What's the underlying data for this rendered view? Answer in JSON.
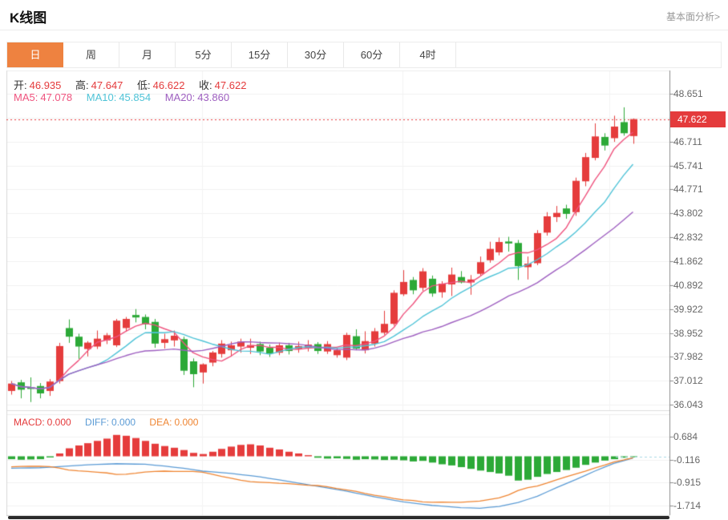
{
  "header": {
    "title": "K线图",
    "more_link": "基本面分析>"
  },
  "toolbar": {
    "tabs": [
      "日",
      "周",
      "月",
      "5分",
      "15分",
      "30分",
      "60分",
      "4时"
    ],
    "tab_ids": [
      "day",
      "week",
      "month",
      "5min",
      "15min",
      "30min",
      "60min",
      "4hour"
    ],
    "active_tab": "日"
  },
  "ohlc": {
    "open_label": "开:",
    "open": "46.935",
    "high_label": "高:",
    "high": "47.647",
    "low_label": "低:",
    "low": "46.622",
    "close_label": "收:",
    "close": "47.622"
  },
  "ma": {
    "ma5_label": "MA5:",
    "ma5": "47.078",
    "ma10_label": "MA10:",
    "ma10": "45.854",
    "ma20_label": "MA20:",
    "ma20": "43.860"
  },
  "macd": {
    "macd_label": "MACD:",
    "macd": "0.000",
    "diff_label": "DIFF:",
    "diff": "0.000",
    "dea_label": "DEA:",
    "dea": "0.000"
  },
  "price_tag": "47.622",
  "colors": {
    "up": "#e53c3c",
    "down": "#2ca937",
    "ma5": "#ef537e",
    "ma10": "#4fc3d7",
    "ma20": "#9e5fc0",
    "diff": "#5b9bd5",
    "dea": "#ef8532",
    "accent": "#ee8240",
    "price_line": "#e43b3c",
    "value_red": "#e43b3c",
    "macd_dash": "#a8d8e6"
  },
  "chart_data": {
    "type": "candlestick",
    "title": "K线图",
    "panes": [
      "price",
      "macd-histogram"
    ],
    "grid": true,
    "legend_position": "top-left-overlay",
    "price_min": 36.043,
    "price_max": 48.651,
    "price_grid_step": 0.9699,
    "current_price": 47.622,
    "price_ticks": [
      "48.651",
      "46.711",
      "45.741",
      "44.771",
      "43.802",
      "42.832",
      "41.862",
      "40.892",
      "39.922",
      "38.952",
      "37.982",
      "37.012",
      "36.043"
    ],
    "price_tick_values": [
      48.651,
      46.711,
      45.741,
      44.771,
      43.802,
      42.832,
      41.862,
      40.892,
      39.922,
      38.952,
      37.982,
      37.012,
      36.043
    ],
    "ma_periods": [
      5,
      10,
      20
    ],
    "candles_ohlc": [
      [
        36.6,
        37.0,
        36.45,
        36.9
      ],
      [
        36.95,
        37.05,
        36.3,
        36.65
      ],
      [
        36.75,
        37.15,
        36.15,
        36.68
      ],
      [
        36.8,
        36.92,
        36.3,
        36.5
      ],
      [
        36.6,
        37.08,
        36.4,
        36.98
      ],
      [
        37.0,
        38.55,
        36.9,
        38.42
      ],
      [
        39.15,
        39.5,
        38.55,
        38.8
      ],
      [
        38.8,
        38.92,
        37.9,
        38.4
      ],
      [
        38.3,
        38.62,
        38.0,
        38.56
      ],
      [
        38.4,
        39.05,
        38.3,
        38.72
      ],
      [
        38.65,
        38.95,
        38.5,
        38.86
      ],
      [
        38.45,
        39.52,
        38.38,
        39.45
      ],
      [
        39.15,
        39.6,
        39.0,
        39.52
      ],
      [
        39.68,
        39.92,
        39.38,
        39.58
      ],
      [
        39.6,
        39.7,
        39.1,
        39.3
      ],
      [
        39.4,
        39.52,
        38.35,
        38.52
      ],
      [
        38.55,
        38.92,
        38.32,
        38.7
      ],
      [
        38.65,
        39.05,
        38.4,
        38.84
      ],
      [
        38.7,
        38.8,
        37.25,
        37.42
      ],
      [
        37.8,
        37.92,
        36.75,
        37.28
      ],
      [
        37.35,
        37.72,
        36.9,
        37.68
      ],
      [
        37.75,
        38.22,
        37.6,
        38.16
      ],
      [
        38.1,
        38.66,
        37.95,
        38.52
      ],
      [
        38.25,
        38.6,
        38.0,
        38.45
      ],
      [
        38.4,
        38.72,
        38.15,
        38.6
      ],
      [
        38.35,
        38.72,
        38.1,
        38.46
      ],
      [
        38.5,
        38.6,
        38.05,
        38.2
      ],
      [
        38.35,
        38.48,
        37.98,
        38.12
      ],
      [
        38.15,
        38.56,
        38.05,
        38.45
      ],
      [
        38.45,
        38.55,
        38.08,
        38.22
      ],
      [
        38.3,
        38.6,
        38.15,
        38.42
      ],
      [
        38.35,
        38.66,
        38.2,
        38.48
      ],
      [
        38.5,
        38.58,
        38.1,
        38.22
      ],
      [
        38.2,
        38.62,
        38.1,
        38.5
      ],
      [
        38.05,
        38.32,
        37.95,
        38.25
      ],
      [
        37.95,
        38.96,
        37.85,
        38.87
      ],
      [
        38.82,
        39.1,
        38.25,
        38.32
      ],
      [
        38.25,
        39.02,
        38.12,
        38.62
      ],
      [
        38.52,
        39.15,
        38.4,
        39.02
      ],
      [
        38.96,
        39.85,
        38.88,
        39.32
      ],
      [
        39.32,
        40.68,
        39.25,
        40.58
      ],
      [
        40.52,
        41.5,
        40.45,
        41.02
      ],
      [
        41.1,
        41.22,
        40.52,
        40.68
      ],
      [
        40.78,
        41.58,
        40.65,
        41.45
      ],
      [
        41.15,
        41.28,
        40.42,
        40.55
      ],
      [
        40.6,
        41.05,
        40.38,
        40.95
      ],
      [
        40.92,
        41.6,
        40.45,
        41.32
      ],
      [
        41.22,
        41.46,
        40.96,
        41.0
      ],
      [
        41.0,
        41.3,
        40.5,
        41.12
      ],
      [
        41.35,
        42.05,
        41.25,
        41.82
      ],
      [
        41.9,
        42.65,
        41.8,
        42.36
      ],
      [
        42.22,
        42.82,
        42.1,
        42.64
      ],
      [
        42.66,
        42.85,
        42.25,
        42.58
      ],
      [
        42.6,
        42.72,
        41.1,
        41.66
      ],
      [
        41.62,
        42.05,
        41.12,
        41.76
      ],
      [
        41.78,
        43.12,
        41.7,
        43.0
      ],
      [
        43.02,
        43.85,
        42.9,
        43.68
      ],
      [
        43.65,
        44.1,
        43.45,
        43.82
      ],
      [
        44.0,
        44.15,
        43.58,
        43.78
      ],
      [
        43.85,
        45.25,
        43.7,
        45.12
      ],
      [
        45.1,
        46.25,
        44.9,
        46.08
      ],
      [
        46.05,
        47.45,
        45.95,
        46.92
      ],
      [
        46.9,
        47.05,
        46.35,
        46.55
      ],
      [
        46.85,
        47.76,
        46.7,
        47.32
      ],
      [
        47.5,
        48.1,
        46.95,
        47.05
      ],
      [
        46.935,
        47.647,
        46.622,
        47.622
      ]
    ],
    "macd_ticks": [
      "0.684",
      "-0.116",
      "-0.915",
      "-1.714"
    ],
    "macd_tick_values": [
      0.684,
      -0.116,
      -0.915,
      -1.714
    ],
    "macd_current": 0.0,
    "macd_histogram": [
      -0.1,
      -0.12,
      -0.11,
      -0.1,
      -0.04,
      0.1,
      0.28,
      0.38,
      0.46,
      0.54,
      0.62,
      0.75,
      0.72,
      0.64,
      0.54,
      0.44,
      0.36,
      0.3,
      0.22,
      0.12,
      0.08,
      0.16,
      0.26,
      0.34,
      0.4,
      0.42,
      0.38,
      0.3,
      0.24,
      0.16,
      0.1,
      0.04,
      -0.05,
      -0.08,
      -0.07,
      -0.09,
      -0.12,
      -0.1,
      -0.11,
      -0.13,
      -0.12,
      -0.14,
      -0.18,
      -0.16,
      -0.22,
      -0.28,
      -0.32,
      -0.38,
      -0.44,
      -0.5,
      -0.55,
      -0.6,
      -0.68,
      -0.85,
      -0.82,
      -0.72,
      -0.62,
      -0.55,
      -0.48,
      -0.4,
      -0.3,
      -0.22,
      -0.15,
      -0.1,
      -0.05,
      -0.02
    ],
    "macd_diff_keypoints": [
      [
        1,
        -0.42
      ],
      [
        4,
        -0.4
      ],
      [
        6,
        -0.36
      ],
      [
        9,
        -0.3
      ],
      [
        12,
        -0.26
      ],
      [
        15,
        -0.28
      ],
      [
        17,
        -0.34
      ],
      [
        19,
        -0.42
      ],
      [
        21,
        -0.52
      ],
      [
        24,
        -0.6
      ],
      [
        27,
        -0.72
      ],
      [
        30,
        -0.88
      ],
      [
        33,
        -1.05
      ],
      [
        36,
        -1.22
      ],
      [
        39,
        -1.42
      ],
      [
        42,
        -1.6
      ],
      [
        45,
        -1.72
      ],
      [
        48,
        -1.8
      ],
      [
        50,
        -1.82
      ],
      [
        52,
        -1.76
      ],
      [
        54,
        -1.62
      ],
      [
        56,
        -1.4
      ],
      [
        58,
        -1.1
      ],
      [
        60,
        -0.82
      ],
      [
        62,
        -0.52
      ],
      [
        64,
        -0.25
      ],
      [
        66,
        -0.06
      ]
    ]
  }
}
